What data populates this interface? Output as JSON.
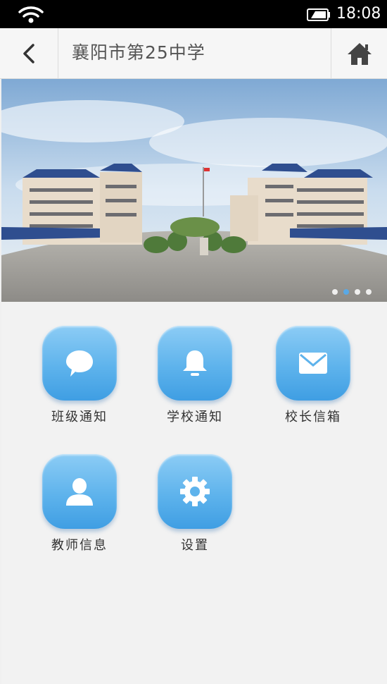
{
  "status_bar": {
    "time": "18:08",
    "wifi_icon": "wifi-icon",
    "battery_icon": "battery-icon"
  },
  "header": {
    "back_icon": "chevron-left-icon",
    "title": "襄阳市第25中学",
    "home_icon": "home-icon"
  },
  "banner": {
    "slide_count": 4,
    "active_slide": 2
  },
  "menu": [
    {
      "label": "班级通知",
      "icon": "chat-bubble-icon"
    },
    {
      "label": "学校通知",
      "icon": "bell-icon"
    },
    {
      "label": "校长信箱",
      "icon": "envelope-icon"
    },
    {
      "label": "教师信息",
      "icon": "person-icon"
    },
    {
      "label": "设置",
      "icon": "gear-icon"
    }
  ],
  "colors": {
    "icon_tile": "#5eb3ec",
    "active_dot": "#5aa9e6",
    "status_bar_bg": "#000000"
  }
}
